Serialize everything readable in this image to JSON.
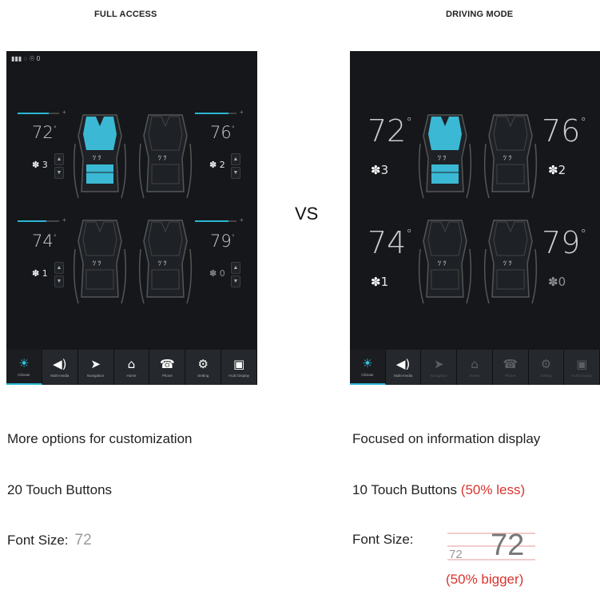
{
  "labels": {
    "left": "FULL ACCESS",
    "right": "DRIVING MODE",
    "vs": "VS"
  },
  "status_bar": "▮▮▮ ◌ ☉ 0",
  "left_screen": {
    "temps": [
      "72",
      "76",
      "74",
      "79"
    ],
    "fans": [
      "3",
      "2",
      "1",
      "0"
    ],
    "sliders": [
      0.75,
      0.8,
      0.7,
      0.8
    ]
  },
  "right_screen": {
    "temps": [
      "72",
      "76",
      "74",
      "79"
    ],
    "fans": [
      "3",
      "2",
      "1",
      "0"
    ]
  },
  "nav_items": [
    {
      "label": "Climate",
      "icon": "sun-icon",
      "glyph": "☀"
    },
    {
      "label": "Multi-media",
      "icon": "speaker-icon",
      "glyph": "◀)"
    },
    {
      "label": "Navigation",
      "icon": "navigation-arrow-icon",
      "glyph": "➤"
    },
    {
      "label": "Home",
      "icon": "home-icon",
      "glyph": "⌂"
    },
    {
      "label": "Phone",
      "icon": "phone-icon",
      "glyph": "☎"
    },
    {
      "label": "Setting",
      "icon": "gear-icon",
      "glyph": "⚙"
    },
    {
      "label": "HUD Display",
      "icon": "hud-icon",
      "glyph": "▣"
    }
  ],
  "captions": {
    "left_1": "More options for customization",
    "left_2": "20 Touch Buttons",
    "left_3_label": "Font Size:",
    "left_3_value": "72",
    "right_1": "Focused on information display",
    "right_2": "10 Touch Buttons",
    "right_2_note": "(50% less)",
    "right_3_label": "Font Size:",
    "right_3_small": "72",
    "right_3_big": "72",
    "right_3_note": "(50% bigger)"
  },
  "colors": {
    "accent": "#2bb7d4",
    "screen_bg": "#15171b",
    "note_red": "#d8342f"
  }
}
